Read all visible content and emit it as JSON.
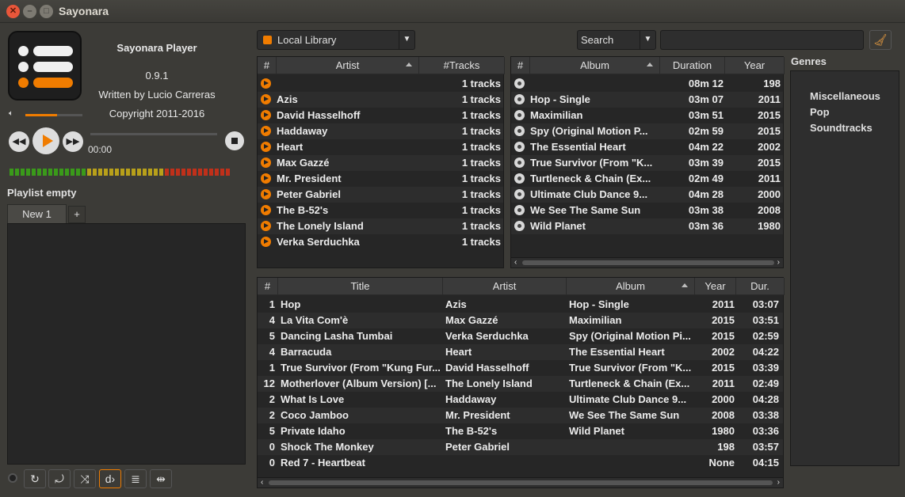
{
  "window": {
    "title": "Sayonara"
  },
  "info": {
    "name": "Sayonara Player",
    "version": "0.9.1",
    "author": "Written by Lucio Carreras",
    "copyright": "Copyright 2011-2016"
  },
  "player": {
    "time": "00:00",
    "volume_level": 0.55,
    "position": 0.0
  },
  "playlist": {
    "status": "Playlist empty",
    "tabs": [
      "New 1"
    ],
    "add_tab": "+"
  },
  "library": {
    "source": "Local Library",
    "search_mode": "Search",
    "search_value": "",
    "genres_label": "Genres"
  },
  "artists": {
    "headers": [
      "#",
      "Artist",
      "#Tracks"
    ],
    "rows": [
      {
        "name": "",
        "tracks": "1 tracks"
      },
      {
        "name": "Azis",
        "tracks": "1 tracks"
      },
      {
        "name": "David Hasselhoff",
        "tracks": "1 tracks"
      },
      {
        "name": "Haddaway",
        "tracks": "1 tracks"
      },
      {
        "name": "Heart",
        "tracks": "1 tracks"
      },
      {
        "name": "Max Gazzé",
        "tracks": "1 tracks"
      },
      {
        "name": "Mr. President",
        "tracks": "1 tracks"
      },
      {
        "name": "Peter Gabriel",
        "tracks": "1 tracks"
      },
      {
        "name": "The B-52's",
        "tracks": "1 tracks"
      },
      {
        "name": "The Lonely Island",
        "tracks": "1 tracks"
      },
      {
        "name": "Verka Serduchka",
        "tracks": "1 tracks"
      }
    ]
  },
  "albums": {
    "headers": [
      "#",
      "Album",
      "Duration",
      "Year"
    ],
    "rows": [
      {
        "name": "",
        "duration": "08m 12",
        "year": "198"
      },
      {
        "name": "Hop - Single",
        "duration": "03m 07",
        "year": "2011"
      },
      {
        "name": "Maximilian",
        "duration": "03m 51",
        "year": "2015"
      },
      {
        "name": "Spy (Original Motion P...",
        "duration": "02m 59",
        "year": "2015"
      },
      {
        "name": "The Essential Heart",
        "duration": "04m 22",
        "year": "2002"
      },
      {
        "name": "True Survivor (From \"K...",
        "duration": "03m 39",
        "year": "2015"
      },
      {
        "name": "Turtleneck & Chain (Ex...",
        "duration": "02m 49",
        "year": "2011"
      },
      {
        "name": "Ultimate Club Dance 9...",
        "duration": "04m 28",
        "year": "2000"
      },
      {
        "name": "We See The Same Sun",
        "duration": "03m 38",
        "year": "2008"
      },
      {
        "name": "Wild Planet",
        "duration": "03m 36",
        "year": "1980"
      }
    ]
  },
  "genres": [
    "Miscellaneous",
    "Pop",
    "Soundtracks"
  ],
  "tracks": {
    "headers": [
      "#",
      "Title",
      "Artist",
      "Album",
      "Year",
      "Dur."
    ],
    "rows": [
      {
        "num": "1",
        "title": "Hop",
        "artist": "Azis",
        "album": "Hop - Single",
        "year": "2011",
        "dur": "03:07"
      },
      {
        "num": "4",
        "title": "La Vita Com'è",
        "artist": "Max Gazzé",
        "album": "Maximilian",
        "year": "2015",
        "dur": "03:51"
      },
      {
        "num": "5",
        "title": "Dancing Lasha Tumbai",
        "artist": "Verka Serduchka",
        "album": "Spy (Original Motion Pi...",
        "year": "2015",
        "dur": "02:59"
      },
      {
        "num": "4",
        "title": "Barracuda",
        "artist": "Heart",
        "album": "The Essential Heart",
        "year": "2002",
        "dur": "04:22"
      },
      {
        "num": "1",
        "title": "True Survivor (From \"Kung Fur...",
        "artist": "David Hasselhoff",
        "album": "True Survivor (From \"K...",
        "year": "2015",
        "dur": "03:39"
      },
      {
        "num": "12",
        "title": "Motherlover (Album Version) [...",
        "artist": "The Lonely Island",
        "album": "Turtleneck & Chain (Ex...",
        "year": "2011",
        "dur": "02:49"
      },
      {
        "num": "2",
        "title": "What Is Love",
        "artist": "Haddaway",
        "album": "Ultimate Club Dance 9...",
        "year": "2000",
        "dur": "04:28"
      },
      {
        "num": "2",
        "title": "Coco Jamboo",
        "artist": "Mr. President",
        "album": "We See The Same Sun",
        "year": "2008",
        "dur": "03:38"
      },
      {
        "num": "5",
        "title": "Private Idaho",
        "artist": "The B-52's",
        "album": "Wild Planet",
        "year": "1980",
        "dur": "03:36"
      },
      {
        "num": "0",
        "title": "Shock The Monkey",
        "artist": "Peter Gabriel",
        "album": "",
        "year": "198",
        "dur": "03:57"
      },
      {
        "num": "0",
        "title": "Red 7 - Heartbeat",
        "artist": "",
        "album": "",
        "year": "None",
        "dur": "04:15"
      }
    ]
  },
  "icons": {
    "close": "close-icon",
    "minimize": "minimize-icon",
    "maximize": "maximize-icon",
    "prev": "previous-icon",
    "play": "play-icon",
    "next": "next-icon",
    "stop": "stop-icon",
    "volume": "volume-icon",
    "library_list": "list-icon",
    "clear_search": "broom-icon",
    "rep1": "repeat-one-icon",
    "repall": "repeat-all-icon",
    "shuffle": "shuffle-icon",
    "dynamic": "dynamic-playback-icon",
    "append": "append-icon",
    "gapless": "gapless-icon"
  },
  "colors": {
    "accent": "#f07c00",
    "background": "#3c3b37",
    "panel": "#262626"
  }
}
